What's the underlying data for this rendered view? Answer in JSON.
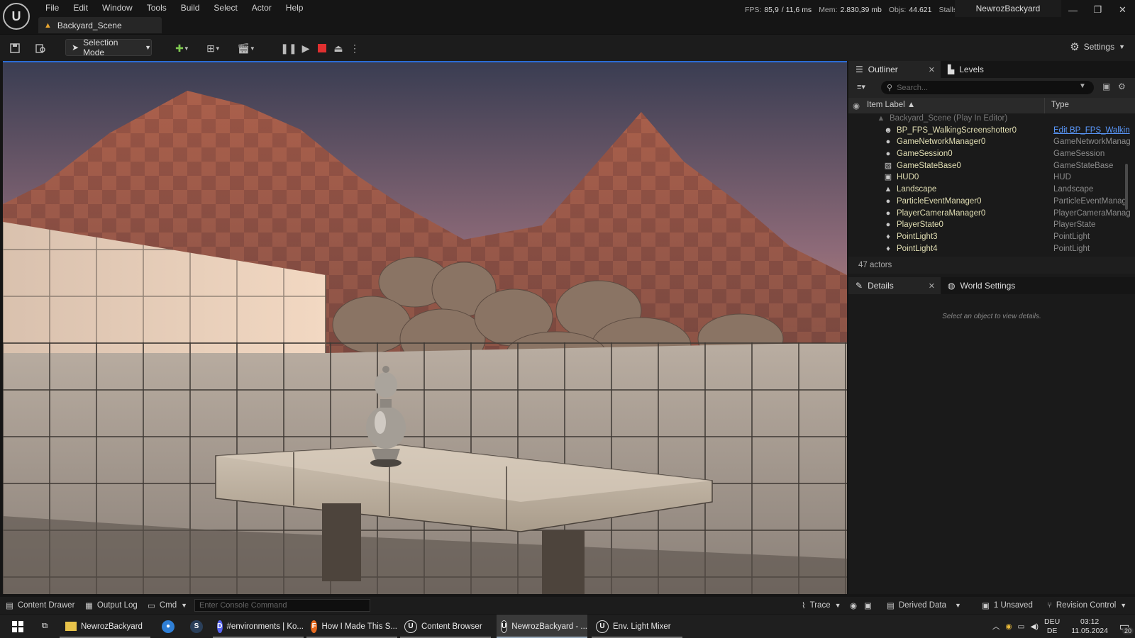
{
  "menu": [
    "File",
    "Edit",
    "Window",
    "Tools",
    "Build",
    "Select",
    "Actor",
    "Help"
  ],
  "doc_tab": "Backyard_Scene",
  "stats": {
    "fps_label": "FPS:",
    "fps": "85,9",
    "ms": "/ 11,6 ms",
    "mem_label": "Mem:",
    "mem": "2.830,39 mb",
    "objs_label": "Objs:",
    "objs": "44.621",
    "stalls_label": "Stalls:",
    "stalls": "0"
  },
  "project_name": "NewrozBackyard",
  "toolbar": {
    "selection_mode": "Selection Mode",
    "settings": "Settings"
  },
  "outliner": {
    "tab": "Outliner",
    "levels_tab": "Levels",
    "search_placeholder": "Search...",
    "col_label": "Item Label ▲",
    "col_type": "Type",
    "parent": "Backyard_Scene (Play In Editor)",
    "rows": [
      {
        "label": "BP_FPS_WalkingScreenshotter0",
        "type": "Edit BP_FPS_Walkin",
        "icon": "person-icon"
      },
      {
        "label": "GameNetworkManager0",
        "type": "GameNetworkManag",
        "icon": "actor-icon"
      },
      {
        "label": "GameSession0",
        "type": "GameSession",
        "icon": "actor-icon"
      },
      {
        "label": "GameStateBase0",
        "type": "GameStateBase",
        "icon": "gamestate-icon"
      },
      {
        "label": "HUD0",
        "type": "HUD",
        "icon": "hud-icon"
      },
      {
        "label": "Landscape",
        "type": "Landscape",
        "icon": "landscape-icon"
      },
      {
        "label": "ParticleEventManager0",
        "type": "ParticleEventManag",
        "icon": "actor-icon"
      },
      {
        "label": "PlayerCameraManager0",
        "type": "PlayerCameraManag",
        "icon": "actor-icon"
      },
      {
        "label": "PlayerState0",
        "type": "PlayerState",
        "icon": "actor-icon"
      },
      {
        "label": "PointLight3",
        "type": "PointLight",
        "icon": "bulb-icon"
      },
      {
        "label": "PointLight4",
        "type": "PointLight",
        "icon": "bulb-icon"
      }
    ],
    "actor_count": "47 actors"
  },
  "details": {
    "tab": "Details",
    "world_tab": "World Settings",
    "empty": "Select an object to view details."
  },
  "statusbar": {
    "content_drawer": "Content Drawer",
    "output_log": "Output Log",
    "cmd": "Cmd",
    "console_placeholder": "Enter Console Command",
    "trace": "Trace",
    "derived_data": "Derived Data",
    "unsaved": "1 Unsaved",
    "revision": "Revision Control"
  },
  "taskbar": {
    "items": [
      {
        "label": "NewrozBackyard"
      },
      {
        "label": "#environments | Ko..."
      },
      {
        "label": "How I Made This S..."
      },
      {
        "label": "Content Browser"
      },
      {
        "label": "NewrozBackyard - ..."
      },
      {
        "label": "Env. Light Mixer"
      }
    ],
    "lang1": "DEU",
    "lang2": "DE",
    "time": "03:12",
    "date": "11.05.2024",
    "notif": "20"
  }
}
